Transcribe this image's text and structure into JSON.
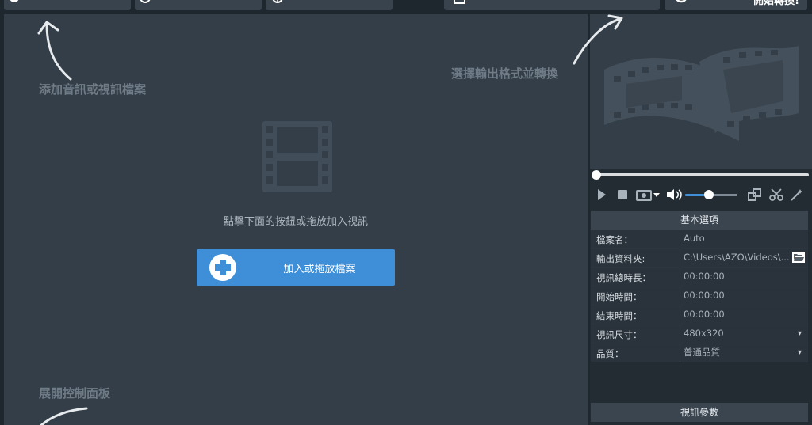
{
  "toolbar": {
    "convert_label": "開始轉換!"
  },
  "main": {
    "hint_add": "添加音訊或視訊檔案",
    "hint_format": "選擇輸出格式並轉換",
    "hint_panel": "展開控制面板",
    "empty_message": "點擊下面的按鈕或拖放加入視訊",
    "add_button_label": "加入或拖放檔案"
  },
  "options": {
    "header": "基本選項",
    "rows": [
      {
        "key": "檔案名：",
        "value": "Auto"
      },
      {
        "key": "輸出資料夾:",
        "value": "C:\\Users\\AZO\\Videos\\..."
      },
      {
        "key": "視訊總時長：",
        "value": "00:00:00"
      },
      {
        "key": "開始時間：",
        "value": "00:00:00"
      },
      {
        "key": "結束時間：",
        "value": "00:00:00"
      },
      {
        "key": "視訊尺寸：",
        "value": "480x320"
      },
      {
        "key": "品質：",
        "value": "普通品質"
      }
    ],
    "params_header": "視訊參數"
  },
  "player": {
    "volume_level": 0.45,
    "seek_position": 0
  },
  "colors": {
    "accent": "#3f8fd8",
    "panel": "#333e48",
    "background": "#1f272e"
  }
}
